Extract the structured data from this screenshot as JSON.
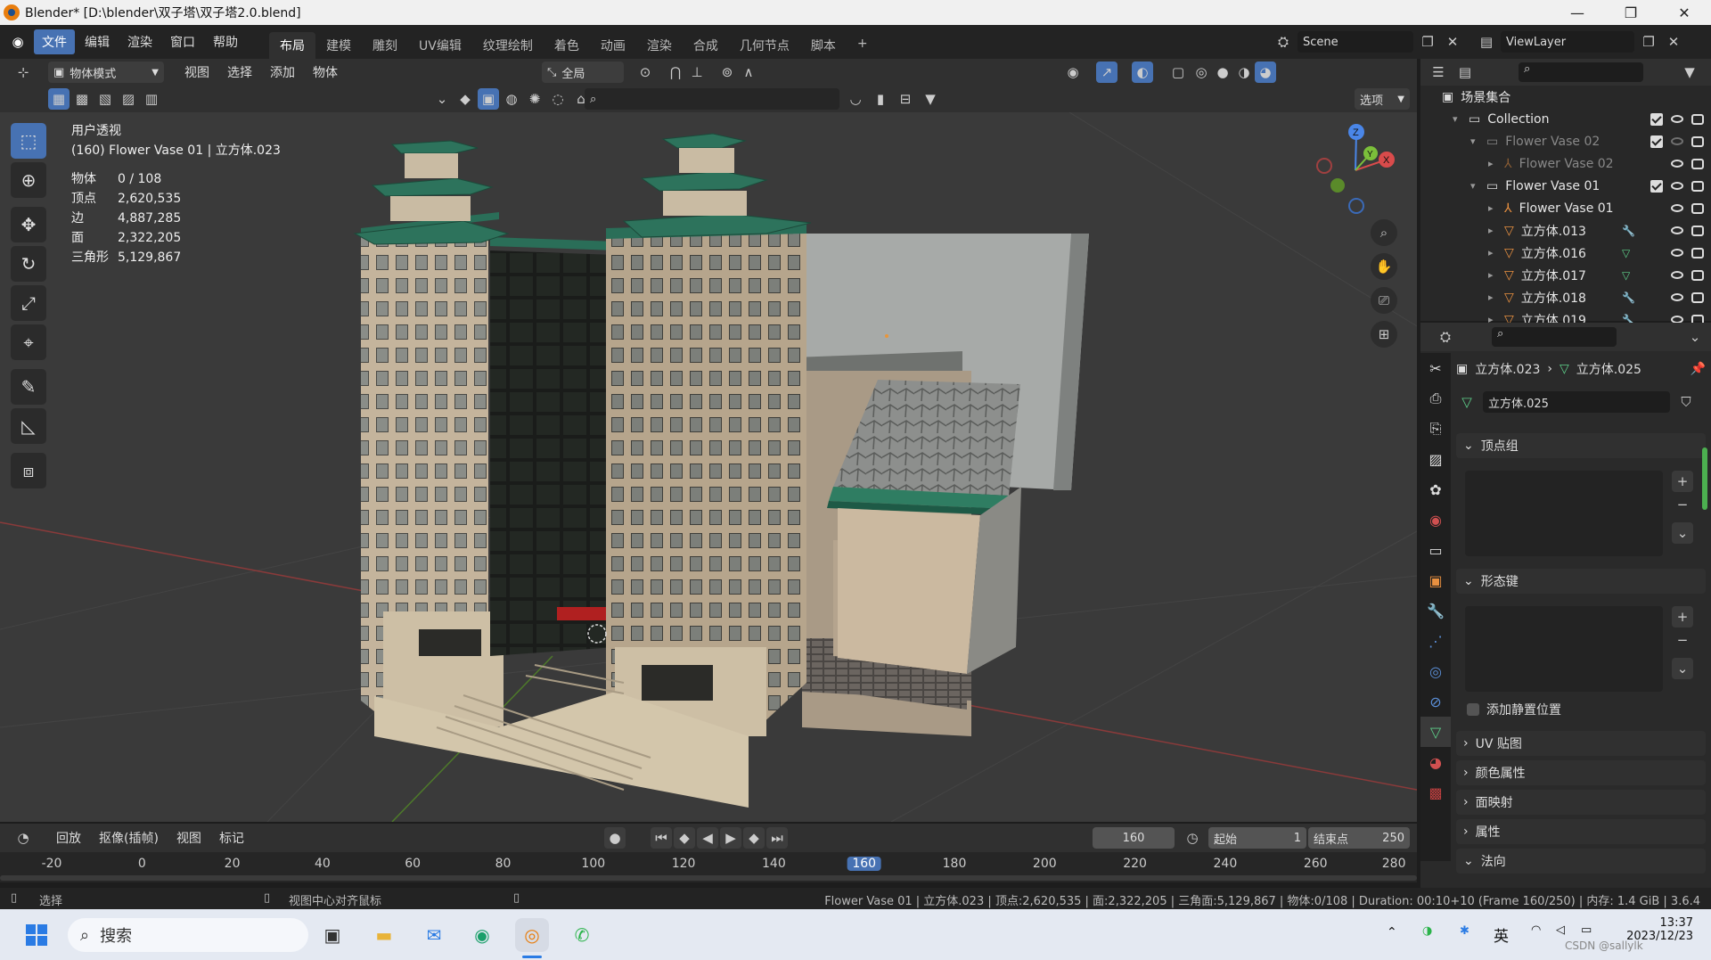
{
  "window": {
    "title": "Blender* [D:\\blender\\双子塔\\双子塔2.0.blend]",
    "minimize": "—",
    "maximize": "❐",
    "close": "✕"
  },
  "menu": {
    "items": [
      "文件",
      "编辑",
      "渲染",
      "窗口",
      "帮助"
    ],
    "workspaces": [
      "布局",
      "建模",
      "雕刻",
      "UV编辑",
      "纹理绘制",
      "着色",
      "动画",
      "渲染",
      "合成",
      "几何节点",
      "脚本"
    ],
    "add_tab": "+",
    "scene_name": "Scene",
    "view_layer": "ViewLayer"
  },
  "viewport_header": {
    "mode": "物体模式",
    "menus": [
      "视图",
      "选择",
      "添加",
      "物体"
    ],
    "transform_orientation": "全局",
    "options": "选项"
  },
  "viewport": {
    "view_name": "用户透视",
    "collection_info": "(160) Flower Vase 01 | 立方体.023",
    "stats": [
      {
        "label": "物体",
        "value": "0 / 108"
      },
      {
        "label": "顶点",
        "value": "2,620,535"
      },
      {
        "label": "边",
        "value": "4,887,285"
      },
      {
        "label": "面",
        "value": "2,322,205"
      },
      {
        "label": "三角形",
        "value": "5,129,867"
      }
    ],
    "gizmo": {
      "z": "Z",
      "y": "Y",
      "x": "X"
    }
  },
  "outliner": {
    "root": "场景集合",
    "rows": [
      {
        "name": "Collection",
        "indent": 1,
        "type": "collection",
        "dim": false,
        "check": true,
        "mod": ""
      },
      {
        "name": "Flower Vase 02",
        "indent": 2,
        "type": "collection",
        "dim": true,
        "check": true,
        "mod": ""
      },
      {
        "name": "Flower Vase 02",
        "indent": 3,
        "type": "armature",
        "dim": true,
        "check": false,
        "mod": ""
      },
      {
        "name": "Flower Vase 01",
        "indent": 2,
        "type": "collection",
        "dim": false,
        "check": true,
        "mod": ""
      },
      {
        "name": "Flower Vase 01",
        "indent": 3,
        "type": "armature",
        "dim": false,
        "check": false,
        "mod": ""
      },
      {
        "name": "立方体.013",
        "indent": 3,
        "type": "mesh",
        "dim": false,
        "check": false,
        "mod": "wrench"
      },
      {
        "name": "立方体.016",
        "indent": 3,
        "type": "mesh",
        "dim": false,
        "check": false,
        "mod": "mesh"
      },
      {
        "name": "立方体.017",
        "indent": 3,
        "type": "mesh",
        "dim": false,
        "check": false,
        "mod": "mesh"
      },
      {
        "name": "立方体.018",
        "indent": 3,
        "type": "mesh",
        "dim": false,
        "check": false,
        "mod": "wrench"
      },
      {
        "name": "立方体.019",
        "indent": 3,
        "type": "mesh",
        "dim": false,
        "check": false,
        "mod": "wrench"
      }
    ]
  },
  "properties": {
    "breadcrumb_object": "立方体.023",
    "breadcrumb_data": "立方体.025",
    "mesh_name": "立方体.025",
    "panels": {
      "vertex_groups": "顶点组",
      "shape_keys": "形态键",
      "relative_checkbox": "添加静置位置",
      "uv_maps": "UV 贴图",
      "color_attributes": "颜色属性",
      "face_maps": "面映射",
      "attributes": "属性",
      "normals": "法向"
    }
  },
  "timeline": {
    "menus": [
      "回放",
      "抠像(插帧)",
      "视图",
      "标记"
    ],
    "current_frame": "160",
    "start_label": "起始",
    "start_value": "1",
    "end_label": "结束点",
    "end_value": "250",
    "ticks": [
      "-20",
      "0",
      "20",
      "40",
      "60",
      "80",
      "100",
      "120",
      "140",
      "160",
      "180",
      "200",
      "220",
      "240",
      "260",
      "280"
    ],
    "current_tick": "160"
  },
  "statusbar": {
    "select": "选择",
    "center": "视图中心对齐鼠标",
    "info": "Flower Vase 01 | 立方体.023 | 顶点:2,620,535 | 面:2,322,205 | 三角面:5,129,867 | 物体:0/108 | Duration: 00:10+10 (Frame 160/250) | 内存: 1.4 GiB | 3.6.4"
  },
  "taskbar": {
    "search_placeholder": "搜索",
    "ime": "英",
    "time": "13:37",
    "date": "2023/12/23",
    "watermark": "CSDN @sallylk"
  },
  "colors": {
    "accent": "#4772b3",
    "header": "#303030",
    "viewport": "#3a3a3a",
    "axis_x": "#d94b4b",
    "axis_y": "#7bbf3a",
    "axis_z": "#4a86e8"
  }
}
